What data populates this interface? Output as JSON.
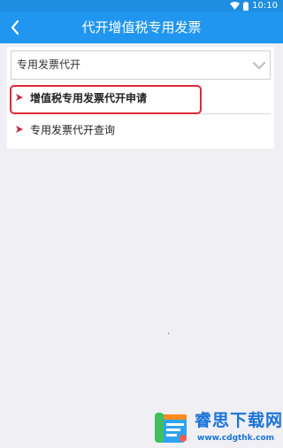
{
  "status_bar": {
    "time": "10:10",
    "icons": [
      "wifi-icon",
      "battery-icon"
    ]
  },
  "header": {
    "title": "代开增值税专用发票",
    "back_icon": "chevron-left-icon"
  },
  "select": {
    "value": "专用发票代开",
    "icon": "chevron-down-icon"
  },
  "menu": {
    "items": [
      {
        "label": "增值税专用发票代开申请",
        "icon": "arrow-right-icon",
        "highlighted": true
      },
      {
        "label": "专用发票代开查询",
        "icon": "arrow-right-icon",
        "highlighted": false
      }
    ]
  },
  "watermark": {
    "title": "睿思下载网",
    "url": "www.cdgthk.com"
  },
  "colors": {
    "header": "#2196f0",
    "status_bar": "#1e8ee0",
    "accent_red": "#e0283a",
    "watermark_blue": "#1a73d8"
  }
}
